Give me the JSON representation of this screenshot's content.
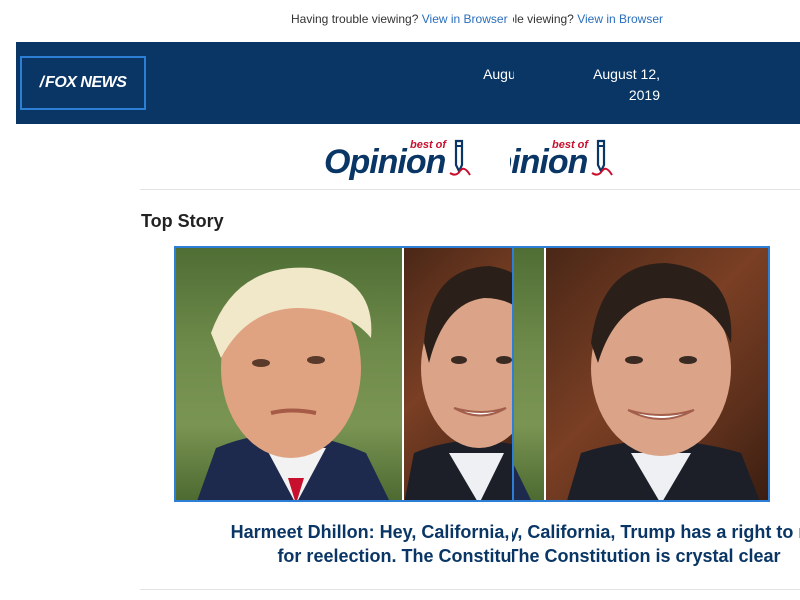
{
  "topbar": {
    "trouble_text": "Having trouble viewing?",
    "view_link": "View in Browser"
  },
  "header": {
    "logo_text": "FOX NEWS",
    "date_line1": "August 12,",
    "date_line2": "2019"
  },
  "branding": {
    "best_of": "best of",
    "opinion": "Opinion"
  },
  "section": {
    "title": "Top Story"
  },
  "story": {
    "headline_line1": "Harmeet Dhillon: Hey, California, Trump has a right to run",
    "headline_line2": "for reelection. The Constitution is crystal clear"
  },
  "colors": {
    "header_navy": "#0a3666",
    "link_blue": "#2a6ebb",
    "frame_blue": "#2d7fd6",
    "brand_red": "#c8102e"
  }
}
